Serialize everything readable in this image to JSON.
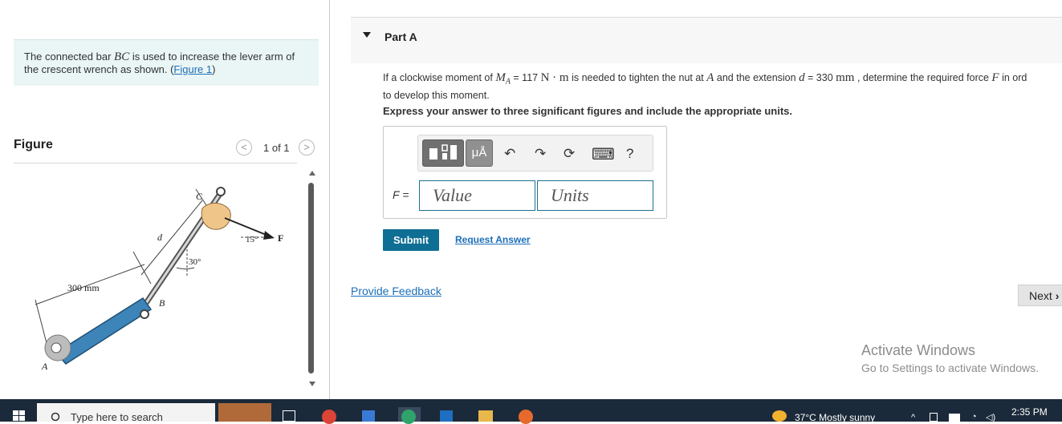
{
  "intro": {
    "text_before": "The connected bar ",
    "var_bc": "BC",
    "text_after": " is used to increase the lever arm of the crescent wrench as shown. (",
    "figure_link": "Figure 1",
    "close": ")"
  },
  "figure_panel": {
    "title": "Figure",
    "counter": "1 of 1",
    "prev_symbol": "<",
    "next_symbol": ">",
    "labels": {
      "c": "C",
      "d": "d",
      "angle_15": "15°",
      "force": "F",
      "angle_30": "30°",
      "length": "300 mm",
      "b": "B",
      "a": "A"
    }
  },
  "part": {
    "title": "Part A",
    "question_1": "If a clockwise moment of ",
    "ma_var": "M",
    "ma_sub": "A",
    "question_2": " = 117 ",
    "unit_nm": "N · m",
    "question_3": " is needed to tighten the nut at ",
    "a_var": "A",
    "question_4": " and the extension ",
    "d_var": "d",
    "question_5": " = 330 ",
    "unit_mm": "mm",
    "question_6": " , determine the required force ",
    "f_var": "F",
    "question_7": " in ord",
    "question_line2": "to develop this moment.",
    "instruction": "Express your answer to three significant figures and include the appropriate units."
  },
  "answer": {
    "label": "F =",
    "value_placeholder": "Value",
    "units_placeholder": "Units",
    "toolbar": {
      "templates_icon": "templates-icon",
      "units_symbol": "μÅ",
      "undo_symbol": "↶",
      "redo_symbol": "↷",
      "reset_symbol": "⟳",
      "keyboard_symbol": "⌨",
      "help_symbol": "?"
    }
  },
  "actions": {
    "submit": "Submit",
    "request_answer": "Request Answer",
    "feedback": "Provide Feedback",
    "next": "Next"
  },
  "watermark": {
    "line1": "Activate Windows",
    "line2": "Go to Settings to activate Windows."
  },
  "taskbar": {
    "search_placeholder": "Type here to search",
    "weather": "37°C  Mostly sunny",
    "time": "2:35 PM"
  },
  "colors": {
    "accent": "#0f6e94",
    "link": "#1c6fb8",
    "wrench": "#3d84b8",
    "intro_bg": "#eaf5f5"
  }
}
